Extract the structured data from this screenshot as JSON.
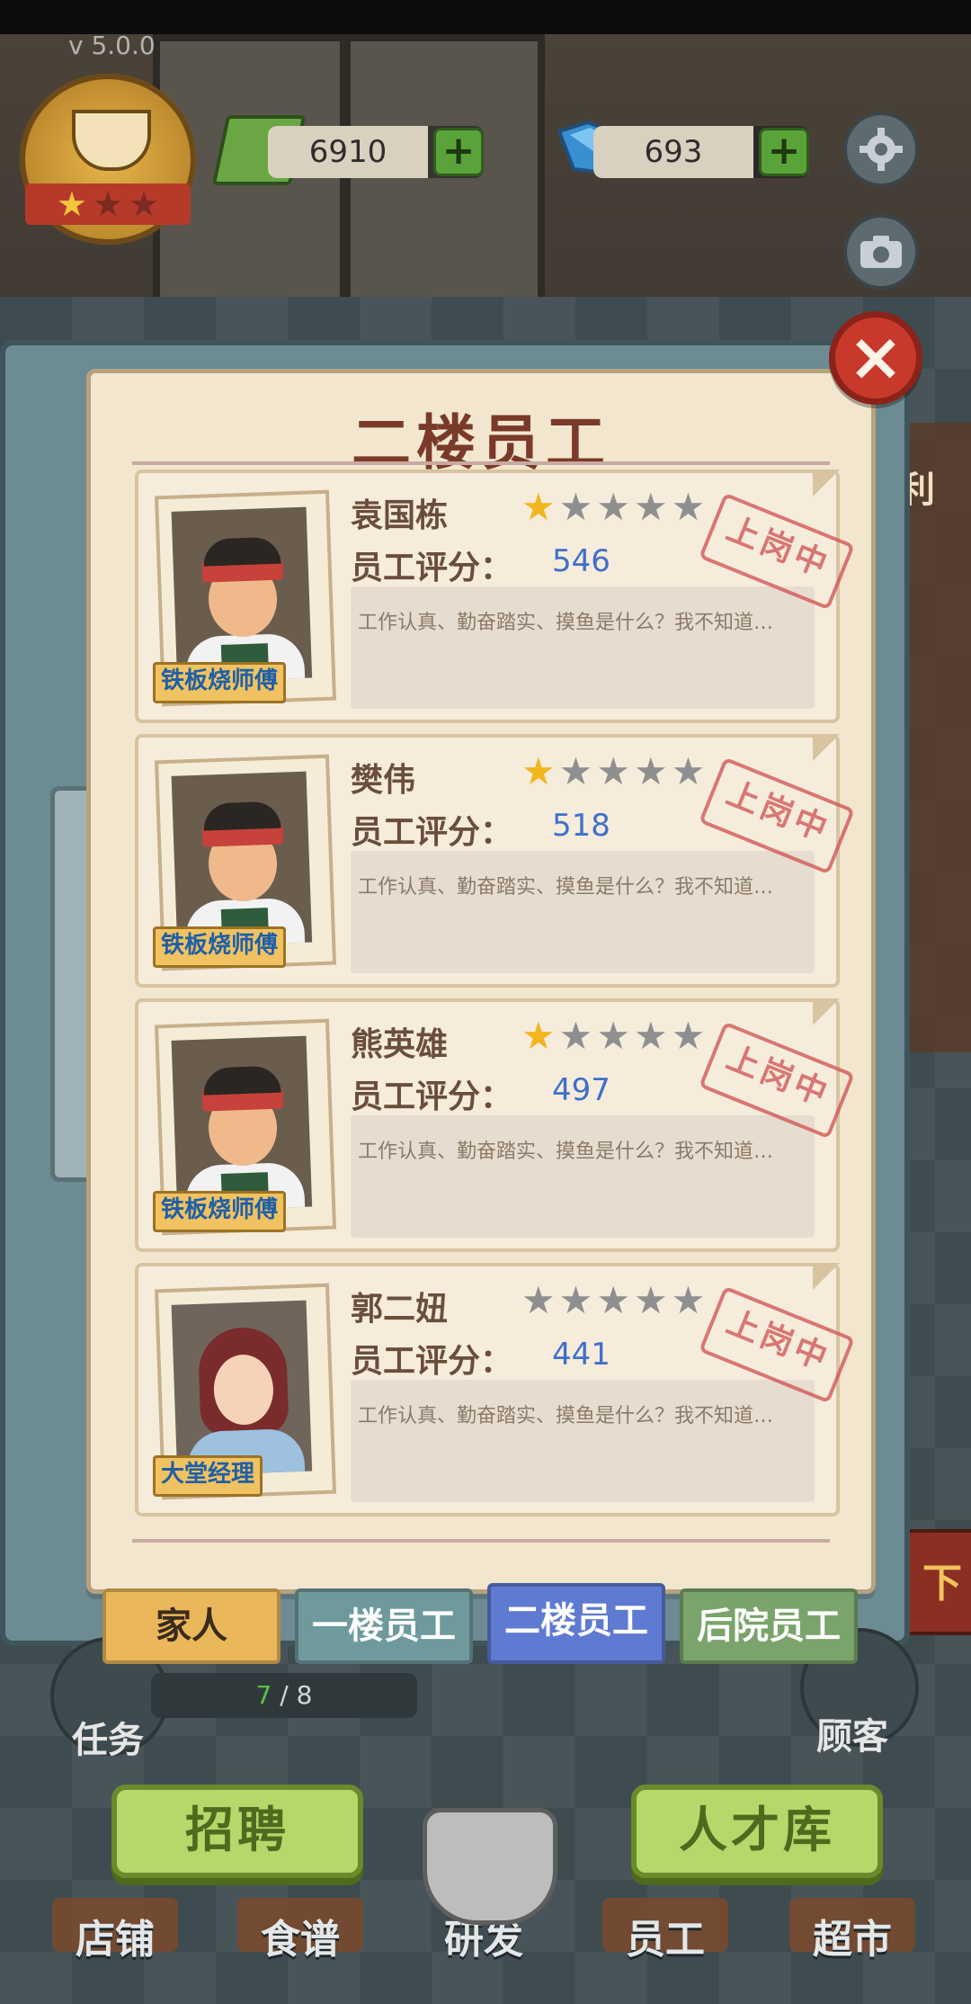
{
  "app": {
    "version": "v 5.0.0"
  },
  "emblem": {
    "stars_lit": 1,
    "stars_total": 3
  },
  "currency": {
    "cash": "6910",
    "gems": "693",
    "plus": "+"
  },
  "dialog": {
    "title": "二楼员工",
    "close": "×"
  },
  "staff": [
    {
      "name": "袁国栋",
      "rating": 1,
      "score_label": "员工评分：",
      "score": "546",
      "role": "铁板烧师傅",
      "desc": "工作认真、勤奋踏实、摸鱼是什么？我不知道…",
      "stamp": "上岗中",
      "avatar": "chef"
    },
    {
      "name": "樊伟",
      "rating": 1,
      "score_label": "员工评分：",
      "score": "518",
      "role": "铁板烧师傅",
      "desc": "工作认真、勤奋踏实、摸鱼是什么？我不知道…",
      "stamp": "上岗中",
      "avatar": "chef"
    },
    {
      "name": "熊英雄",
      "rating": 1,
      "score_label": "员工评分：",
      "score": "497",
      "role": "铁板烧师傅",
      "desc": "工作认真、勤奋踏实、摸鱼是什么？我不知道…",
      "stamp": "上岗中",
      "avatar": "chef"
    },
    {
      "name": "郭二妞",
      "rating": 0,
      "score_label": "员工评分：",
      "score": "441",
      "role": "大堂经理",
      "desc": "工作认真、勤奋踏实、摸鱼是什么？我不知道…",
      "stamp": "上岗中",
      "avatar": "manager"
    }
  ],
  "tabs": {
    "family": "家人",
    "floor1": "一楼员工",
    "floor2": "二楼员工",
    "yard": "后院员工",
    "active": "floor2"
  },
  "task": {
    "label": "任务",
    "progress_done": "7",
    "progress_rest": " / 8"
  },
  "customer": {
    "label": "顾客"
  },
  "side_text": {
    "top": "利",
    "bottom": "下"
  },
  "actions": {
    "recruit": "招聘",
    "talent": "人才库"
  },
  "nav": {
    "items": [
      "店铺",
      "食谱",
      "研发",
      "员工",
      "超市"
    ]
  },
  "colors": {
    "accent_red": "#c8382b",
    "score_blue": "#3f6fc9",
    "star_gold": "#f2b61e",
    "button_green": "#b4d86a"
  },
  "icons": {
    "settings": "gear-icon",
    "camera": "camera-icon",
    "close": "close-icon",
    "star": "star-icon"
  }
}
